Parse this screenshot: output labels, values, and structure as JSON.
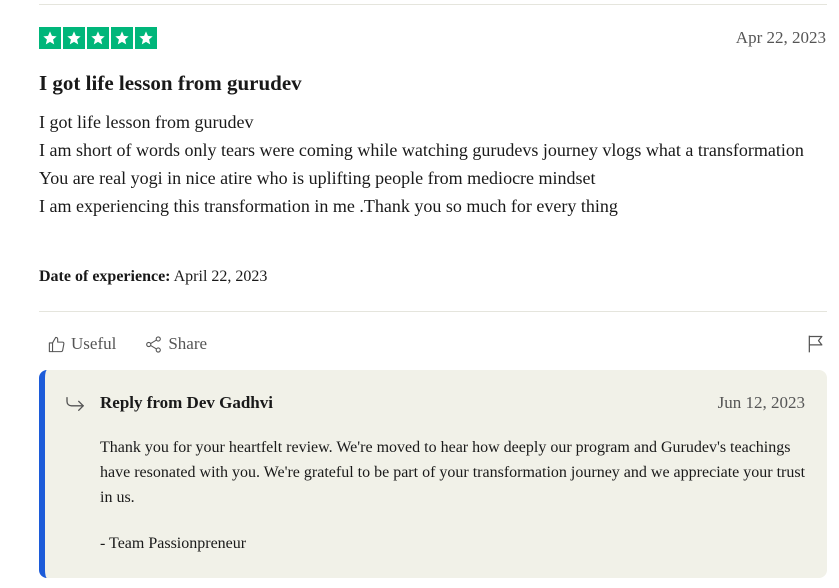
{
  "review": {
    "rating": 5,
    "date": "Apr 22, 2023",
    "title": "I got life lesson from gurudev",
    "body_lines": [
      "I got life lesson from gurudev",
      "I am short of words only tears were coming while watching gurudevs journey vlogs what a transformation",
      "You are real yogi in nice atire who is uplifting people from mediocre mindset",
      "I am experiencing this transformation in me .Thank you so much for every thing"
    ],
    "experience_label": "Date of experience:",
    "experience_date": "April 22, 2023"
  },
  "actions": {
    "useful_label": "Useful",
    "share_label": "Share"
  },
  "reply": {
    "from_label": "Reply from Dev Gadhvi",
    "date": "Jun 12, 2023",
    "text": "Thank you for your heartfelt review. We're moved to hear how deeply our program and Gurudev's teachings have resonated with you. We're grateful to be part of your transformation journey and we appreciate your trust in us.",
    "signature": "- Team Passionpreneur"
  },
  "colors": {
    "star_green": "#00b67a",
    "reply_accent": "#1c5bd9",
    "reply_bg": "#f1f1e8"
  },
  "icons": [
    "star-icon",
    "thumbs-up-icon",
    "share-icon",
    "flag-icon",
    "reply-arrow-icon"
  ]
}
